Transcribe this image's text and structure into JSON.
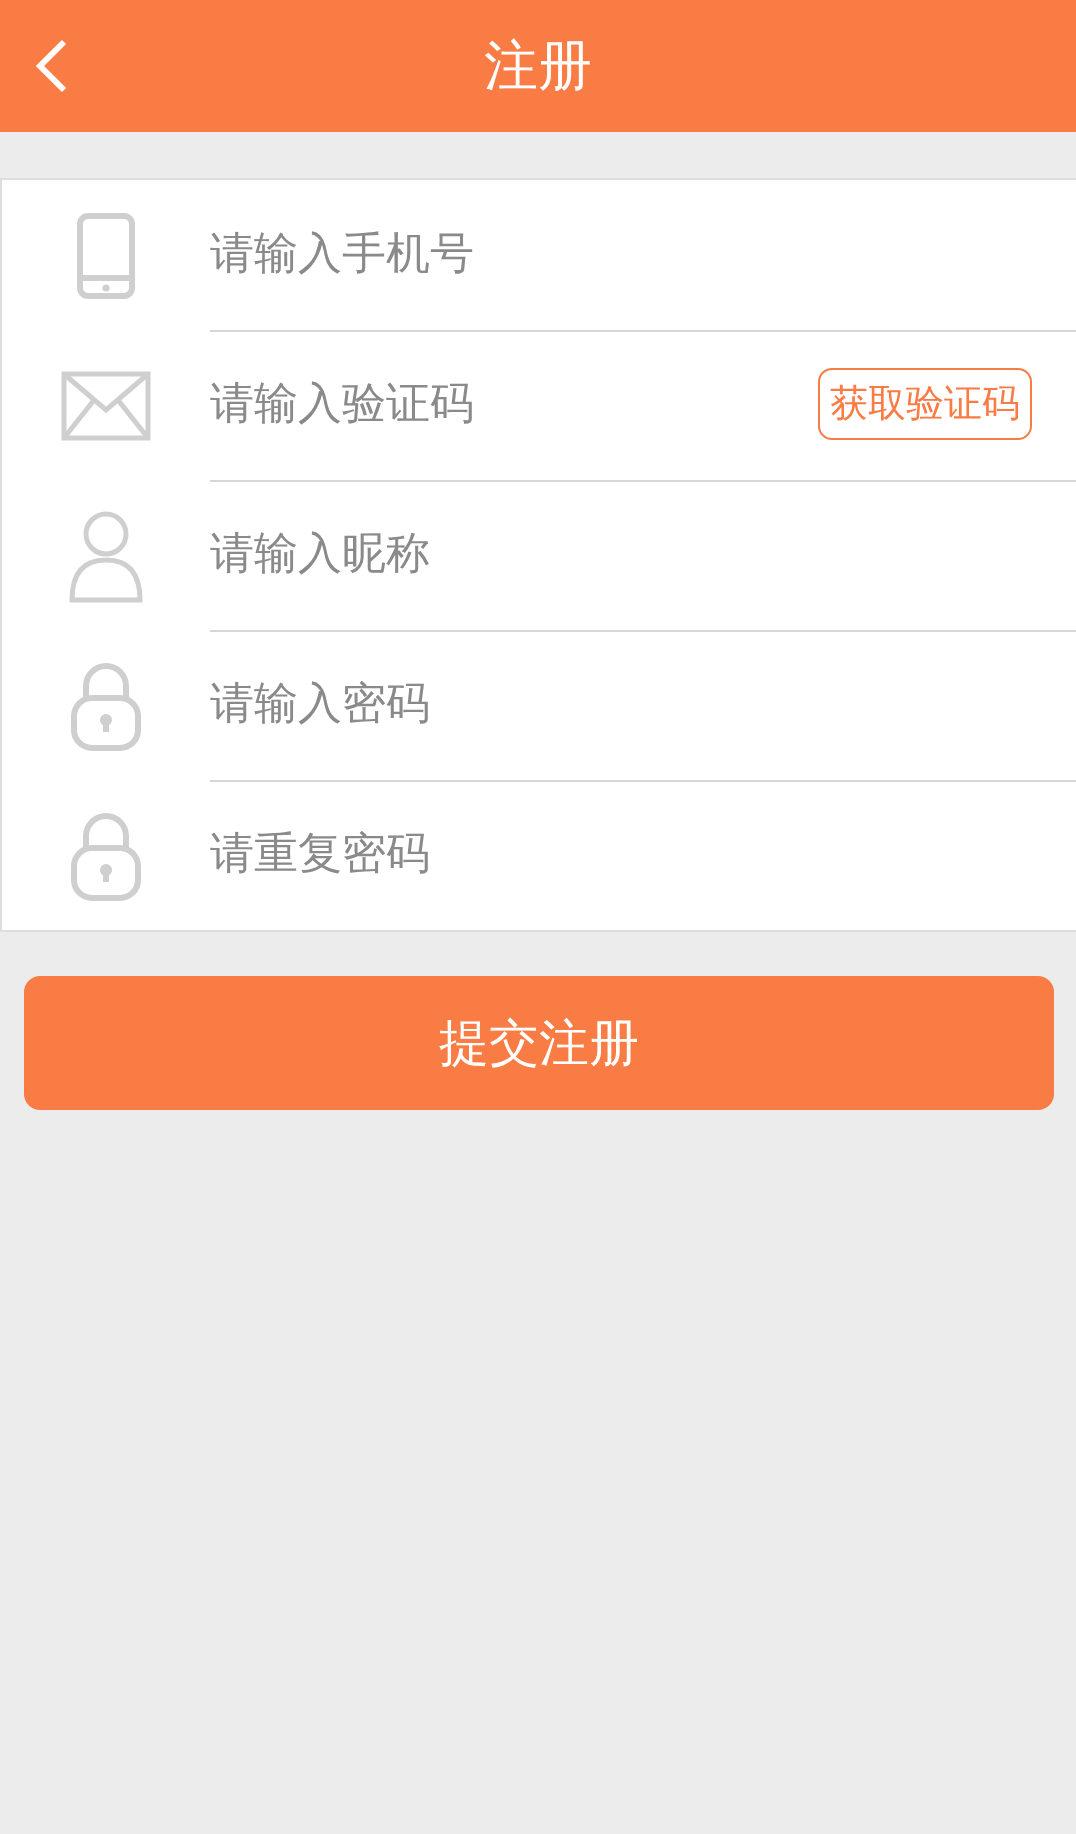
{
  "header": {
    "title": "注册"
  },
  "fields": [
    {
      "placeholder": "请输入手机号"
    },
    {
      "placeholder": "请输入验证码",
      "action": "获取验证码"
    },
    {
      "placeholder": "请输入昵称"
    },
    {
      "placeholder": "请输入密码"
    },
    {
      "placeholder": "请重复密码"
    }
  ],
  "submit": "提交注册"
}
